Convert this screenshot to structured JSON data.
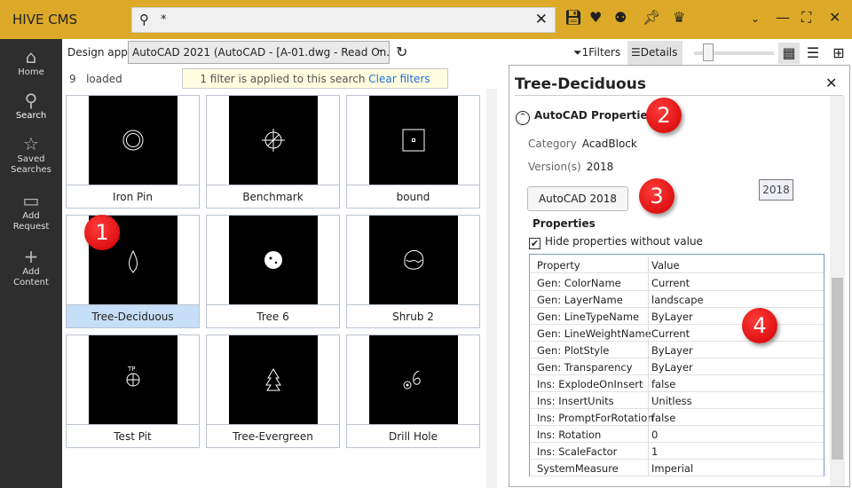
{
  "app": {
    "title": "HIVE CMS",
    "search_value": "*"
  },
  "sidebar": {
    "items": [
      {
        "label": "Home",
        "icon": "home-icon"
      },
      {
        "label": "Search",
        "icon": "search-icon"
      },
      {
        "label": "Saved Searches",
        "icon": "saved-searches-icon"
      },
      {
        "label": "Add Request",
        "icon": "inbox-icon"
      },
      {
        "label": "Add Content",
        "icon": "plus-icon"
      }
    ]
  },
  "toolbar": {
    "design_app_label": "Design app:",
    "design_app_value": "AutoCAD 2021 (AutoCAD  - [A-01.dwg - Read On...",
    "filters_label": "1Filters",
    "details_label": "Details"
  },
  "results": {
    "count": "9",
    "loaded_label": "loaded",
    "banner_text": "1 filter is applied to this search",
    "clear_filters": "Clear filters",
    "items": [
      {
        "label": "Iron Pin"
      },
      {
        "label": "Benchmark"
      },
      {
        "label": "bound"
      },
      {
        "label": "Tree-Deciduous",
        "selected": true
      },
      {
        "label": "Tree 6"
      },
      {
        "label": "Shrub 2"
      },
      {
        "label": "Test Pit"
      },
      {
        "label": "Tree-Evergreen"
      },
      {
        "label": "Drill Hole"
      }
    ]
  },
  "details": {
    "title": "Tree-Deciduous",
    "section": "AutoCAD Properties",
    "category_label": "Category",
    "category_value": "AcadBlock",
    "version_label": "Version(s)",
    "version_value": "2018",
    "version_button": "AutoCAD  2018",
    "version_tag": "2018",
    "properties_label": "Properties",
    "hide_checkbox": "Hide properties without value",
    "hide_checked": true,
    "table": {
      "headers": [
        "Property",
        "Value"
      ],
      "rows": [
        [
          "Gen: ColorName",
          "Current"
        ],
        [
          "Gen: LayerName",
          "landscape"
        ],
        [
          "Gen: LineTypeName",
          "ByLayer"
        ],
        [
          "Gen: LineWeightName",
          "Current"
        ],
        [
          "Gen: PlotStyle",
          "ByLayer"
        ],
        [
          "Gen: Transparency",
          "ByLayer"
        ],
        [
          "Ins: ExplodeOnInsert",
          "false"
        ],
        [
          "Ins: InsertUnits",
          "Unitless"
        ],
        [
          "Ins: PromptForRotation",
          "false"
        ],
        [
          "Ins: Rotation",
          "0"
        ],
        [
          "Ins: ScaleFactor",
          "1"
        ],
        [
          "SystemMeasure",
          "Imperial"
        ]
      ]
    }
  },
  "annotations": [
    "1",
    "2",
    "3",
    "4"
  ],
  "colors": {
    "topbar": "#dcaa28",
    "sidebar": "#2e2e2e",
    "selection": "#c6def6",
    "badge": "#e00000"
  }
}
